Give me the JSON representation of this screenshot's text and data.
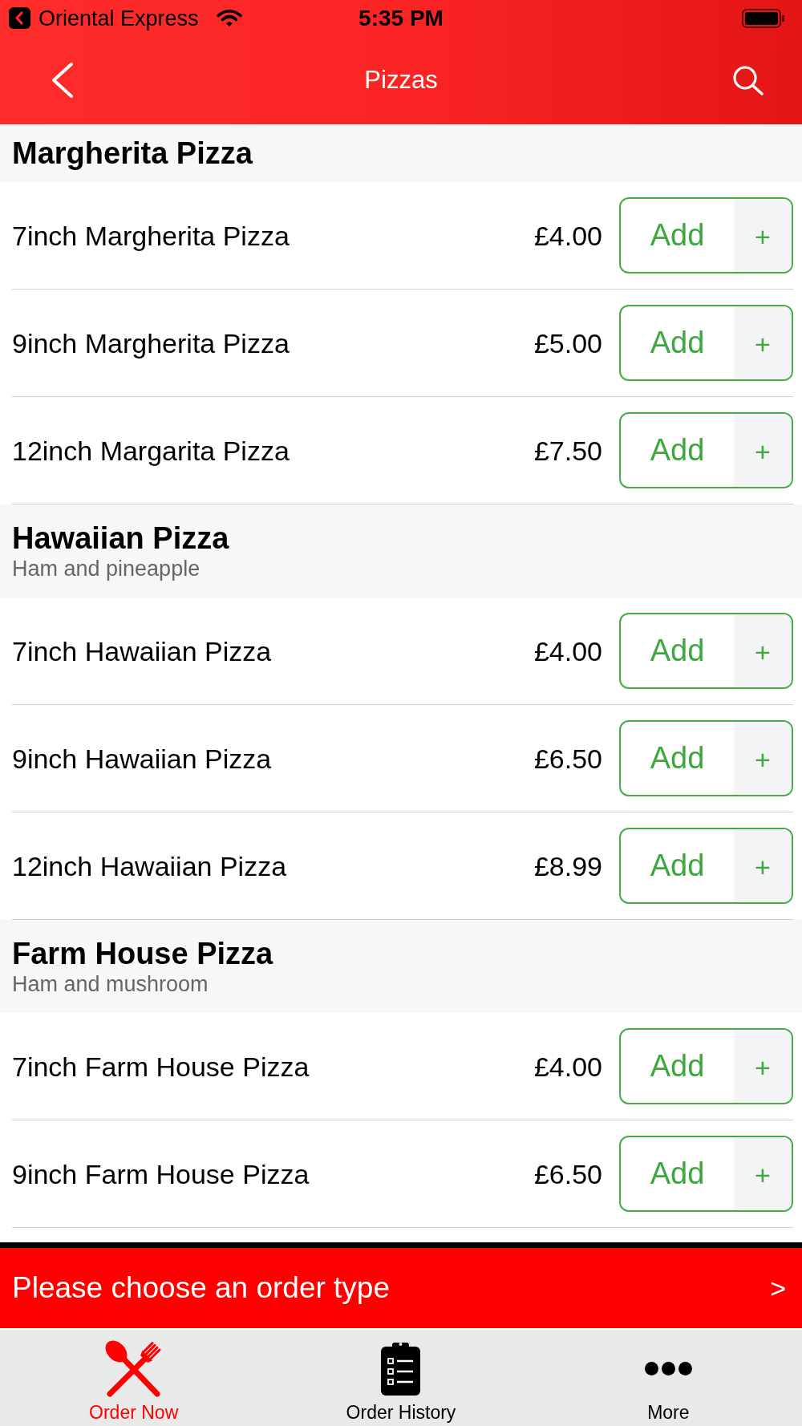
{
  "status_bar": {
    "back_app_label": "Oriental Express",
    "time": "5:35 PM"
  },
  "nav_bar": {
    "title": "Pizzas"
  },
  "sections": [
    {
      "title": "Margherita Pizza",
      "items": [
        {
          "name": "7inch Margherita Pizza",
          "price": "£4.00",
          "button": "Add",
          "plus": "+"
        },
        {
          "name": "9inch Margherita Pizza",
          "price": "£5.00",
          "button": "Add",
          "plus": "+"
        },
        {
          "name": "12inch Margarita Pizza",
          "price": "£7.50",
          "button": "Add",
          "plus": "+"
        }
      ]
    },
    {
      "title": "Hawaiian Pizza",
      "subtitle": "Ham and pineapple",
      "items": [
        {
          "name": "7inch Hawaiian Pizza",
          "price": "£4.00",
          "button": "Add",
          "plus": "+"
        },
        {
          "name": "9inch Hawaiian Pizza",
          "price": "£6.50",
          "button": "Add",
          "plus": "+"
        },
        {
          "name": "12inch Hawaiian Pizza",
          "price": "£8.99",
          "button": "Add",
          "plus": "+"
        }
      ]
    },
    {
      "title": "Farm House Pizza",
      "subtitle": "Ham and mushroom",
      "items": [
        {
          "name": "7inch Farm House Pizza",
          "price": "£4.00",
          "button": "Add",
          "plus": "+"
        },
        {
          "name": "9inch Farm House Pizza",
          "price": "£6.50",
          "button": "Add",
          "plus": "+"
        }
      ]
    }
  ],
  "order_type_bar": {
    "label": "Please choose an order type",
    "arrow": ">"
  },
  "tab_bar": [
    {
      "label": "Order Now",
      "selected": true
    },
    {
      "label": "Order History",
      "selected": false
    },
    {
      "label": "More",
      "selected": false
    }
  ]
}
